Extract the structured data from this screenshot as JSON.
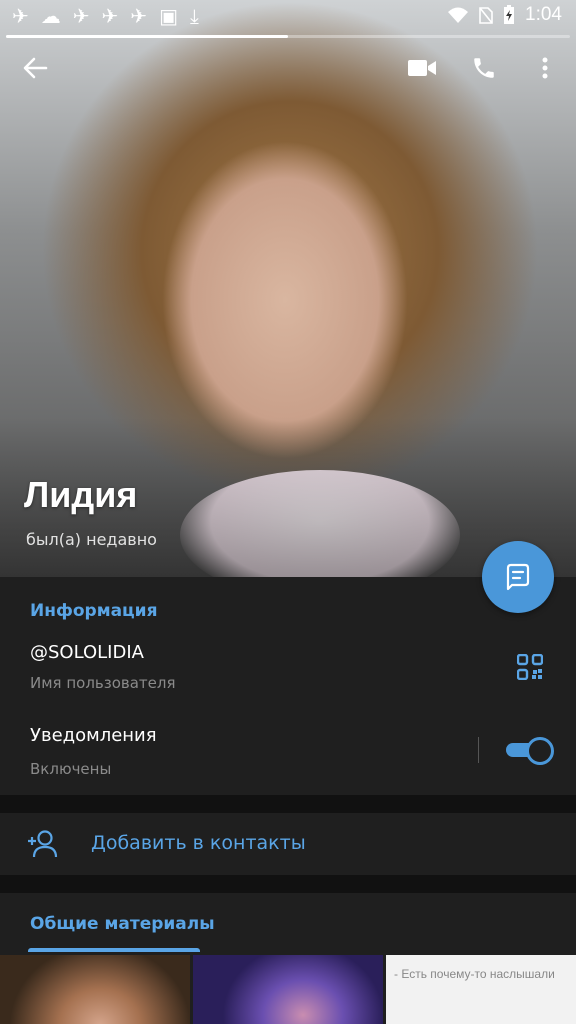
{
  "status_bar": {
    "time": "1:04",
    "left_icons": [
      "telegram-icon",
      "cloud-icon",
      "telegram-icon",
      "telegram-icon",
      "telegram-icon",
      "image-icon",
      "download-icon"
    ],
    "right_icons": [
      "wifi-icon",
      "no-sim-icon",
      "battery-charging-icon"
    ]
  },
  "story_progress": 0.5,
  "profile": {
    "name": "Лидия",
    "last_seen": "был(а) недавно"
  },
  "info": {
    "section_title": "Информация",
    "username": "@SOLOLIDIA",
    "username_label": "Имя пользователя",
    "notifications_title": "Уведомления",
    "notifications_status": "Включены",
    "notifications_enabled": true
  },
  "actions": {
    "add_contact": "Добавить в контакты"
  },
  "shared": {
    "section_title": "Общие материалы",
    "thumb3_text": "- Есть почему-то наслышали"
  },
  "colors": {
    "accent": "#4a97d9",
    "panel_bg": "#1f1f1f",
    "divider_bg": "#111111"
  }
}
